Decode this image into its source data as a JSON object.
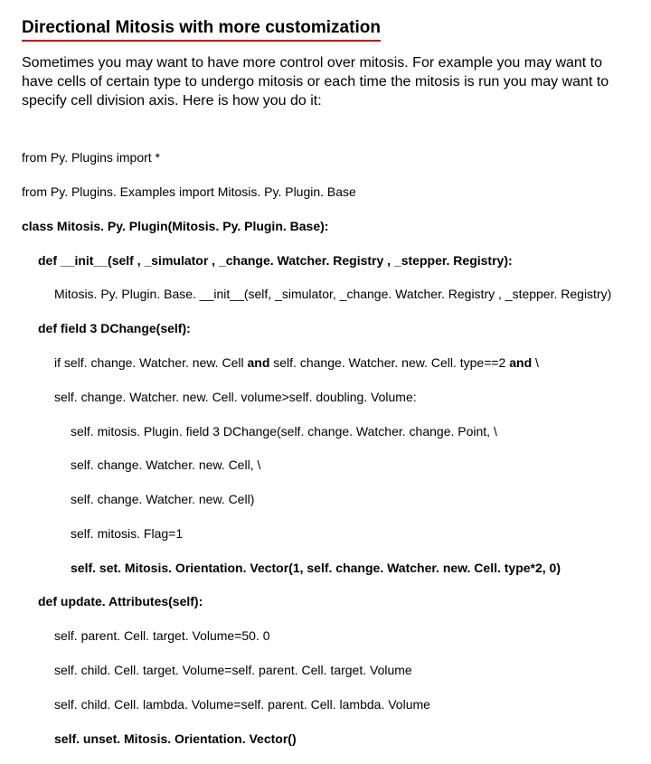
{
  "title": "Directional Mitosis with more customization",
  "intro": "Sometimes you may want to have more control over mitosis. For example you may want to have cells of certain type to undergo mitosis or each time the mitosis is run you may want to specify cell division axis. Here is how you do it:",
  "code": {
    "l1": "from Py. Plugins import *",
    "l2": "from Py. Plugins. Examples import Mitosis. Py. Plugin. Base",
    "l3a": "class Mitosis. Py. Plugin(Mitosis. Py. Plugin. Base):",
    "l4a": "def __init__(self , _simulator , _change. Watcher. Registry , _stepper. Registry):",
    "l5": "Mitosis. Py. Plugin. Base. __init__(self, _simulator, _change. Watcher. Registry , _stepper. Registry)",
    "l6a": "def field 3 DChange(self):",
    "l7a": "if self. change. Watcher. new. Cell ",
    "l7b": "and",
    "l7c": " self. change. Watcher. new. Cell. type==2 ",
    "l7d": "and",
    "l7e": " \\",
    "l8": "self. change. Watcher. new. Cell. volume>self. doubling. Volume:",
    "l9": "self. mitosis. Plugin. field 3 DChange(self. change. Watcher. change. Point, \\",
    "l10": "self. change. Watcher. new. Cell, \\",
    "l11": "self. change. Watcher. new. Cell)",
    "l12": "self. mitosis. Flag=1",
    "l13a": "self. set. Mitosis. Orientation. Vector(1, self. change. Watcher. new. Cell. type*2, 0)",
    "l14a": "def update. Attributes(self):",
    "l15": "self. parent. Cell. target. Volume=50. 0",
    "l16": "self. child. Cell. target. Volume=self. parent. Cell. target. Volume",
    "l17": "self. child. Cell. lambda. Volume=self. parent. Cell. lambda. Volume",
    "l18a": "self. unset. Mitosis. Orientation. Vector()"
  }
}
